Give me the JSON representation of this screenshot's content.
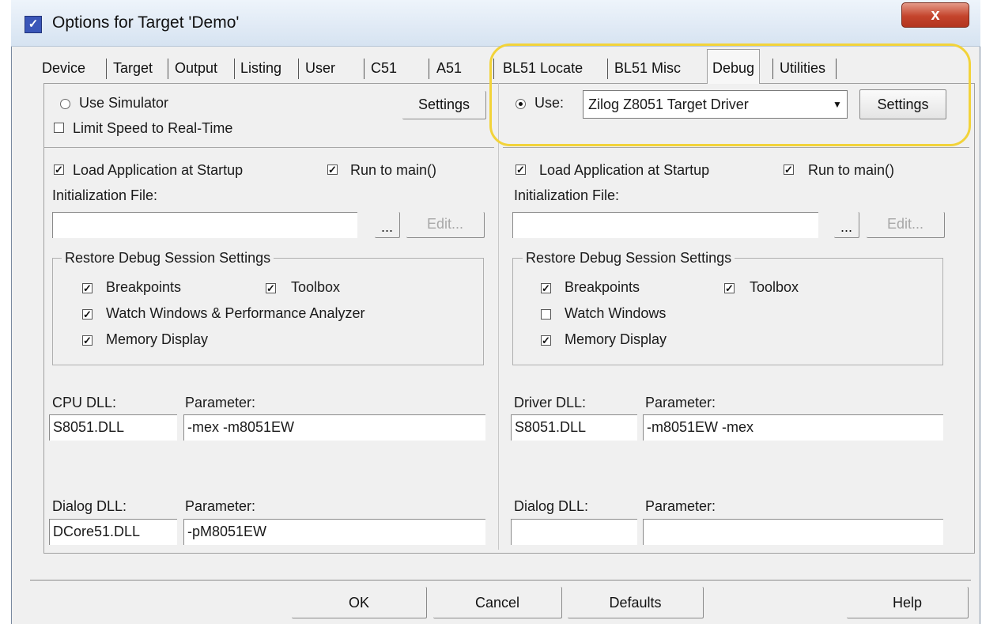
{
  "window": {
    "title": "Options for Target 'Demo'",
    "close_label": "x"
  },
  "tabs": [
    "Device",
    "Target",
    "Output",
    "Listing",
    "User",
    "C51",
    "A51",
    "BL51 Locate",
    "BL51 Misc",
    "Debug",
    "Utilities"
  ],
  "left": {
    "use_simulator": "Use Simulator",
    "limit_speed": "Limit Speed to Real-Time",
    "settings": "Settings",
    "load_app": "Load Application at Startup",
    "run_to_main": "Run to main()",
    "init_file": "Initialization File:",
    "init_value": "",
    "browse": "...",
    "edit": "Edit...",
    "restore_title": "Restore Debug Session Settings",
    "breakpoints": "Breakpoints",
    "toolbox": "Toolbox",
    "watch": "Watch Windows & Performance Analyzer",
    "memory": "Memory Display",
    "cpu_dll_label": "CPU DLL:",
    "cpu_param_label": "Parameter:",
    "cpu_dll": "S8051.DLL",
    "cpu_param": "-mex -m8051EW",
    "dialog_dll_label": "Dialog DLL:",
    "dialog_param_label": "Parameter:",
    "dialog_dll": "DCore51.DLL",
    "dialog_param": "-pM8051EW"
  },
  "right": {
    "use": "Use:",
    "driver": "Zilog Z8051 Target Driver",
    "settings": "Settings",
    "load_app": "Load Application at Startup",
    "run_to_main": "Run to main()",
    "init_file": "Initialization File:",
    "init_value": "",
    "browse": "...",
    "edit": "Edit...",
    "restore_title": "Restore Debug Session Settings",
    "breakpoints": "Breakpoints",
    "toolbox": "Toolbox",
    "watch": "Watch Windows",
    "memory": "Memory Display",
    "driver_dll_label": "Driver DLL:",
    "driver_param_label": "Parameter:",
    "driver_dll": "S8051.DLL",
    "driver_param": "-m8051EW -mex",
    "dialog_dll_label": "Dialog DLL:",
    "dialog_param_label": "Parameter:",
    "dialog_dll": "",
    "dialog_param": ""
  },
  "footer": {
    "ok": "OK",
    "cancel": "Cancel",
    "defaults": "Defaults",
    "help": "Help"
  },
  "checkmark": "✓",
  "colors": {
    "highlight": "#f2d33a",
    "close": "#c4442c"
  }
}
